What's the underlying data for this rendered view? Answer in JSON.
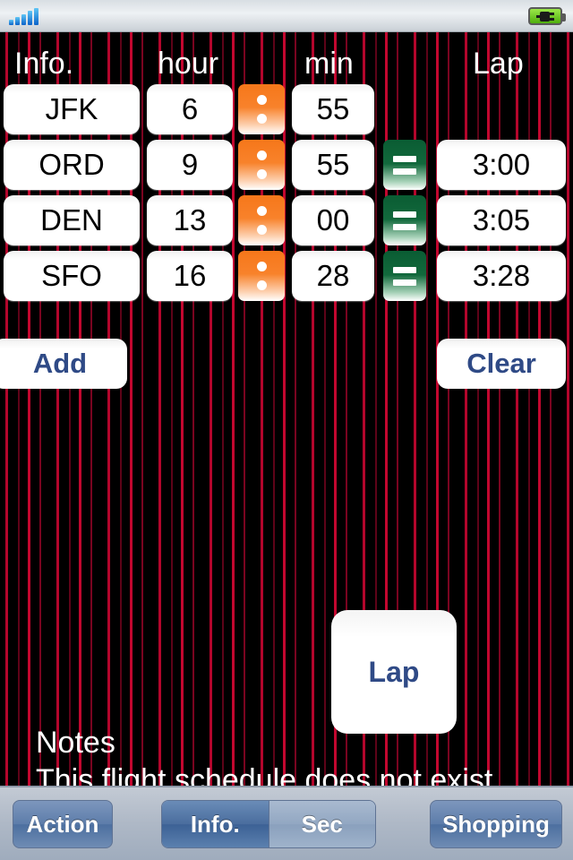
{
  "statusbar": {
    "signal_icon": "signal-bars-icon",
    "signal_bars": 5,
    "battery_icon": "battery-charging-icon"
  },
  "table": {
    "headers": {
      "info": "Info.",
      "hour": "hour",
      "min": "min",
      "lap": "Lap"
    },
    "rows": [
      {
        "info": "JFK",
        "hour": "6",
        "separator": ":",
        "min": "55",
        "equals": "=",
        "lap": "",
        "has_equals": false
      },
      {
        "info": "ORD",
        "hour": "9",
        "separator": ":",
        "min": "55",
        "equals": "=",
        "lap": "3:00",
        "has_equals": true
      },
      {
        "info": "DEN",
        "hour": "13",
        "separator": ":",
        "min": "00",
        "equals": "=",
        "lap": "3:05",
        "has_equals": true
      },
      {
        "info": "SFO",
        "hour": "16",
        "separator": ":",
        "min": "28",
        "equals": "=",
        "lap": "3:28",
        "has_equals": true
      }
    ]
  },
  "actions": {
    "add_label": "Add",
    "clear_label": "Clear",
    "lap_button_label": "Lap"
  },
  "notes": {
    "title": "Notes",
    "body": "This flight schedule does not exist."
  },
  "toolbar": {
    "action_label": "Action",
    "segment": {
      "selected": "Info.",
      "options": [
        "Info.",
        "Sec"
      ]
    },
    "shopping_label": "Shopping"
  },
  "colors": {
    "background": "#000000",
    "stripe_red": "#b3062c",
    "accent_blue": "#2f4a86",
    "separator_orange": "#f6771a",
    "equals_green": "#0a5c33",
    "toolbar_blue": "#4c6f9f"
  }
}
